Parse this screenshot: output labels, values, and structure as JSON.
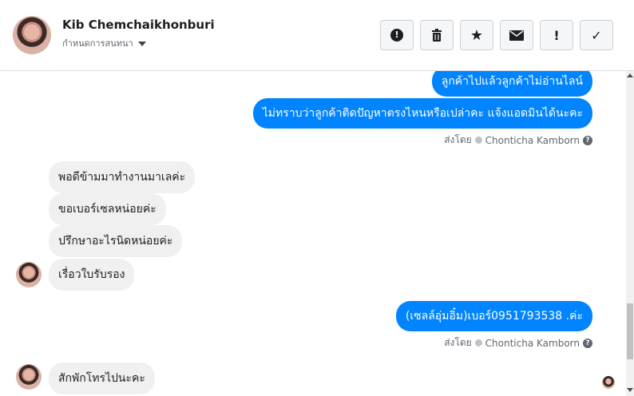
{
  "header": {
    "contact_name": "Kib Chemchaikhonburi",
    "subtitle": "กำหนดการสนทนา",
    "actions": [
      {
        "name": "report-icon",
        "glyph": "❗"
      },
      {
        "name": "trash-icon",
        "glyph": "🗑"
      },
      {
        "name": "star-icon",
        "glyph": "★"
      },
      {
        "name": "mail-icon",
        "glyph": "✉"
      },
      {
        "name": "exclamation-icon",
        "glyph": "!"
      },
      {
        "name": "check-icon",
        "glyph": "✓"
      }
    ]
  },
  "messages": {
    "out1": "ลูกค้าไปแล้วลูกค้าไม่อ่านไลน์",
    "out2": "ไม่ทราบว่าลูกค้าติดปัญหาตรงไหนหรือเปล่าคะ แจ้งแอดมินได้นะคะ",
    "sent_by_1": "ส่งโดย",
    "sender_1": "Chonticha Kamborn",
    "in1": "พอดีข้ามมาทำงานมาเลค่ะ",
    "in2": "ขอเบอร์เซลหน่อยค่ะ",
    "in3": "ปรึกษาอะไรนิดหน่อยค่ะ",
    "in4": "เรื่อวใบรับรอง",
    "out3": "(เซลล์อุ่มอิ๋ม)เบอร์0951793538 .ค่ะ",
    "sent_by_2": "ส่งโดย",
    "sender_2": "Chonticha Kamborn",
    "in5": "สักพักโทรไปนะคะ"
  },
  "colors": {
    "outgoing": "#0084ff",
    "incoming": "#f1f0f0"
  }
}
